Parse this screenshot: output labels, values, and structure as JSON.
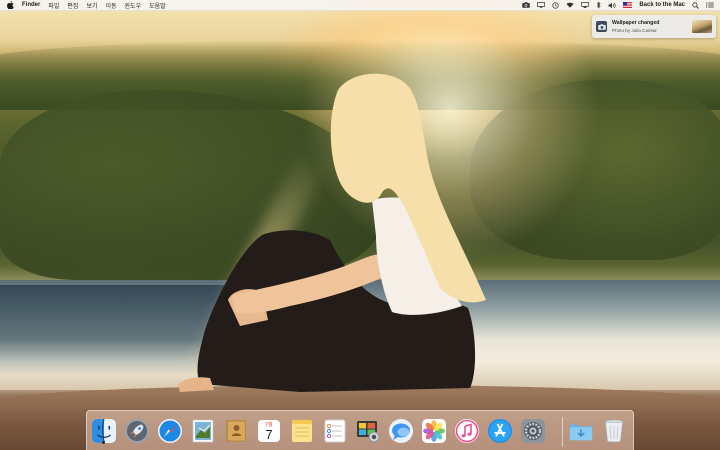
{
  "menubar": {
    "app_name": "Finder",
    "menus": [
      "파일",
      "편집",
      "보기",
      "이동",
      "윈도우",
      "도움말"
    ],
    "user_name": "Back to the Mac"
  },
  "notification": {
    "title": "Wallpaper changed",
    "subtitle": "Photo by Julia Caesar",
    "icon": "camera-icon"
  },
  "dock": {
    "calendar_day": "7",
    "calendar_month": "7월",
    "items": [
      "finder",
      "launchpad",
      "safari",
      "mail",
      "contacts",
      "calendar",
      "notes",
      "reminders",
      "photo-booth",
      "messages",
      "photos",
      "itunes",
      "app-store",
      "system-preferences",
      "downloads-stack",
      "trash"
    ],
    "running": [
      "finder"
    ]
  },
  "colors": {
    "menubar_bg": "#f6f4f0",
    "dock_tint": "#f0d2be",
    "safari_blue": "#1e88e5",
    "itunes_pink": "#ef4f92"
  }
}
